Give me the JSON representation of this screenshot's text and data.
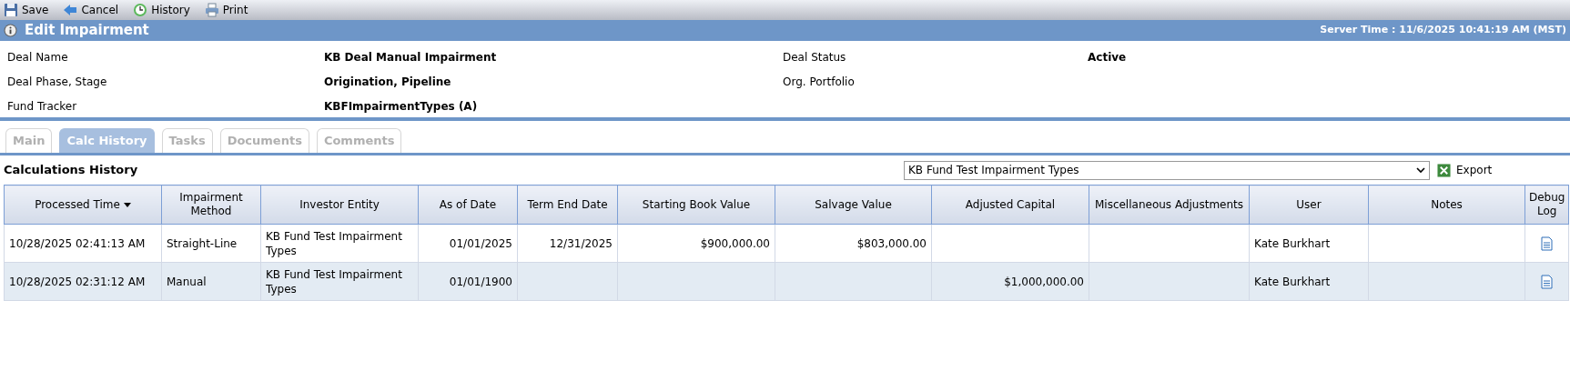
{
  "toolbar": [
    {
      "label": "Save"
    },
    {
      "label": "Cancel"
    },
    {
      "label": "History"
    },
    {
      "label": "Print"
    }
  ],
  "header": {
    "title": "Edit Impairment",
    "server_time": "Server Time : 11/6/2025 10:41:19 AM (MST)"
  },
  "details": [
    {
      "label": "Deal Name",
      "value": "KB Deal Manual Impairment",
      "label_2": "Deal Status",
      "value_2": "Active"
    },
    {
      "label": "Deal Phase, Stage",
      "value": "Origination, Pipeline",
      "label_2": "Org. Portfolio"
    },
    {
      "label": "Fund Tracker",
      "value": "KBFImpairmentTypes (A)"
    }
  ],
  "tabs": [
    {
      "label": "Main",
      "selected": false
    },
    {
      "label": "Calc History",
      "selected": true
    },
    {
      "label": "Tasks",
      "selected": false
    },
    {
      "label": "Documents",
      "selected": false
    },
    {
      "label": "Comments",
      "selected": false
    }
  ],
  "section_title": "Calculations History",
  "fund_select": {
    "value": "KB Fund Test Impairment Types"
  },
  "export": "Export",
  "table": {
    "columns": [
      {
        "label": "Processed Time",
        "sorted": true,
        "kind": "text"
      },
      {
        "label": "Impairment Method",
        "kind": "text"
      },
      {
        "label": "Investor Entity",
        "kind": "text"
      },
      {
        "label": "As of Date",
        "kind": "number"
      },
      {
        "label": "Term End Date",
        "kind": "number"
      },
      {
        "label": "Starting Book Value",
        "kind": "number"
      },
      {
        "label": "Salvage Value",
        "kind": "number"
      },
      {
        "label": "Adjusted Capital",
        "kind": "number"
      },
      {
        "label": "Miscellaneous Adjustments",
        "kind": "number"
      },
      {
        "label": "User",
        "kind": "text"
      },
      {
        "label": "Notes",
        "kind": "text"
      },
      {
        "label": "Debug Log",
        "kind": "icon"
      }
    ],
    "rows": [
      {
        "cells": [
          "10/28/2025 02:41:13 AM",
          "Straight-Line",
          "KB Fund Test Impairment Types",
          "01/01/2025",
          "12/31/2025",
          "$900,000.00",
          "$803,000.00",
          "",
          "",
          "Kate Burkhart",
          ""
        ]
      },
      {
        "cells": [
          "10/28/2025 02:31:12 AM",
          "Manual",
          "KB Fund Test Impairment Types",
          "01/01/1900",
          "",
          "",
          "",
          "$1,000,000.00",
          "",
          "Kate Burkhart",
          ""
        ]
      }
    ]
  }
}
